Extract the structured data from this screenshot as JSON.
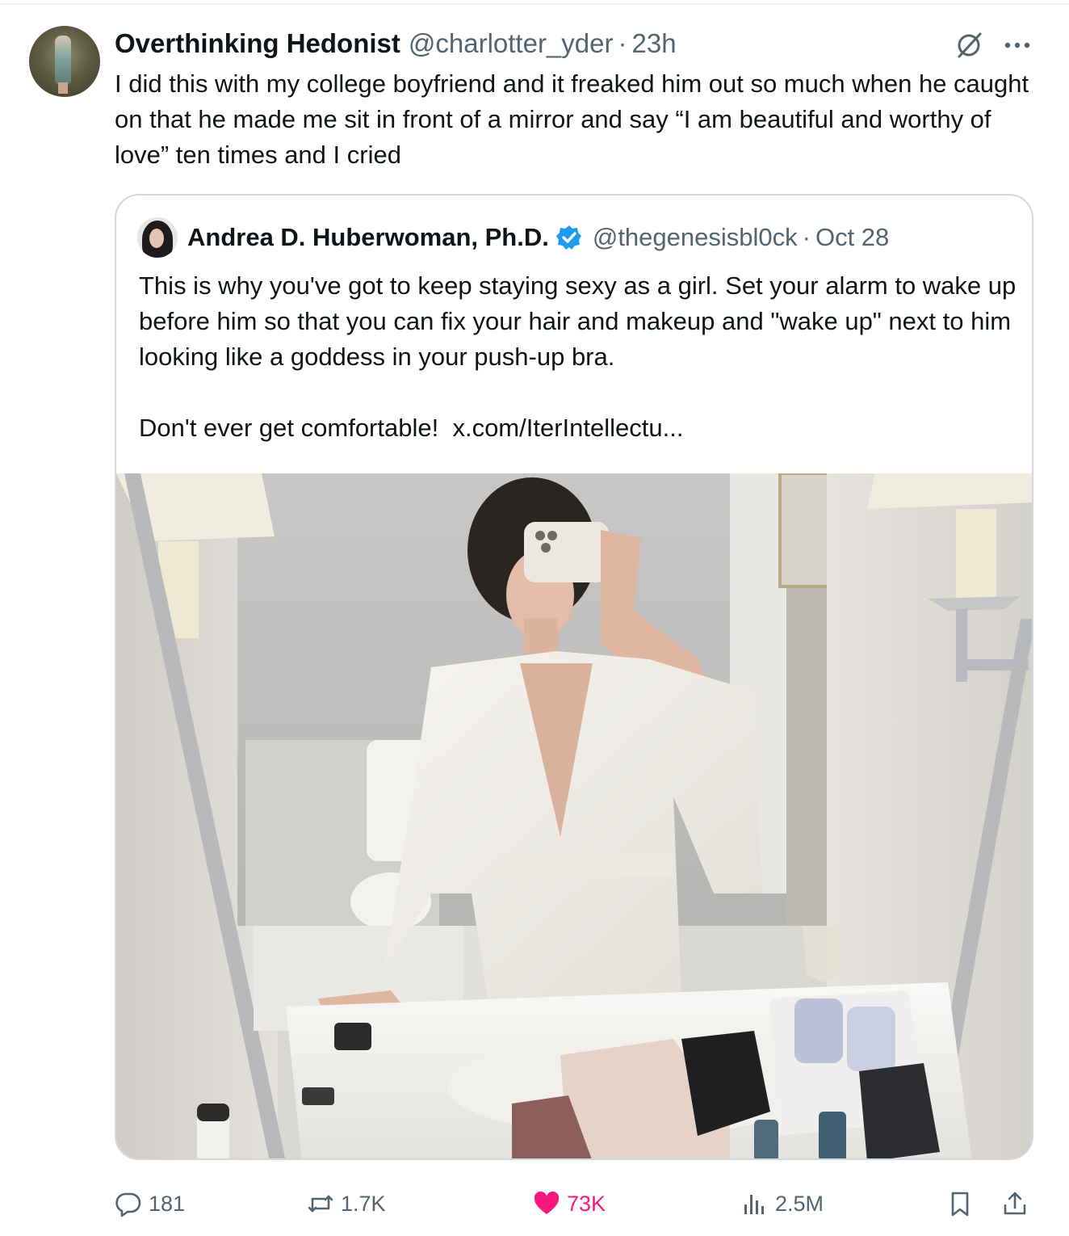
{
  "tweet": {
    "author_name": "Overthinking Hedonist",
    "author_handle": "@charlotter_yder",
    "separator": "·",
    "time": "23h",
    "text": "I did this with my college boyfriend and it freaked him out so much when he caught on that he made me sit in front of a mirror and say “I am beautiful and worthy of love” ten times and I cried"
  },
  "quote": {
    "author_name": "Andrea D. Huberwoman, Ph.D.",
    "verified": true,
    "author_handle": "@thegenesisbl0ck",
    "separator": "·",
    "time": "Oct 28",
    "paragraph1": "This is why you've got to keep staying sexy as a girl. Set your alarm to wake up before him so that you can fix your hair and makeup and \"wake up\" next to him looking like a goddess in your push-up bra.",
    "paragraph2": "Don't ever get comfortable!",
    "link": "x.com/IterIntellectu..."
  },
  "actions": {
    "replies": "181",
    "reposts": "1.7K",
    "likes": "73K",
    "views": "2.5M"
  },
  "icons": {
    "grok": "grok-icon",
    "more": "more-icon",
    "verified": "verified-badge-icon",
    "reply": "reply-icon",
    "repost": "repost-icon",
    "like": "heart-icon",
    "views": "views-icon",
    "bookmark": "bookmark-icon",
    "share": "share-icon"
  },
  "colors": {
    "text": "#0f1419",
    "secondary": "#536471",
    "like": "#f91880",
    "verified": "#1d9bf0",
    "border": "#cfd9de"
  }
}
